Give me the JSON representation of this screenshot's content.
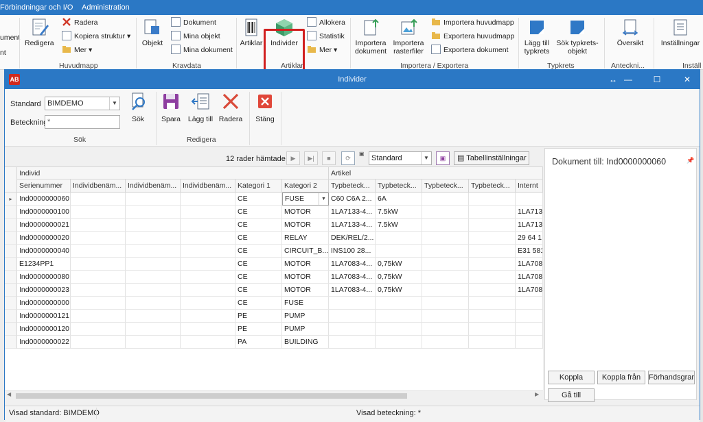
{
  "app": {
    "tabs": [
      "Förbindningar och I/O",
      "Administration"
    ],
    "ribbon": {
      "left_cut": [
        "ument",
        "nt"
      ],
      "huvudmapp": {
        "label": "Huvudmapp",
        "redigera": "Redigera",
        "radera": "Radera",
        "kopiera": "Kopiera struktur",
        "mer": "Mer"
      },
      "kravdata": {
        "label": "Kravdata",
        "objekt": "Objekt",
        "dokument": "Dokument",
        "mina_objekt": "Mina objekt",
        "mina_dokument": "Mina dokument"
      },
      "artiklar": {
        "label": "Artiklar",
        "artiklar": "Artiklar",
        "individer": "Individer",
        "allokera": "Allokera",
        "statistik": "Statistik",
        "mer": "Mer"
      },
      "importera": {
        "label": "Importera / Exportera",
        "imp_dok_1": "Importera",
        "imp_dok_2": "dokument",
        "imp_rast_1": "Importera",
        "imp_rast_2": "rasterfiler",
        "imp_huvud": "Importera huvudmapp",
        "exp_huvud": "Exportera huvudmapp",
        "exp_dok": "Exportera dokument"
      },
      "typkrets": {
        "label": "Typkrets",
        "lagg_1": "Lägg till",
        "lagg_2": "typkrets",
        "sok_1": "Sök typkrets-",
        "sok_2": "objekt"
      },
      "anteckning": {
        "label": "Anteckni...",
        "oversikt": "Översikt"
      },
      "installningar": {
        "label": "Inställ",
        "btn": "Inställningar"
      }
    }
  },
  "dialog": {
    "logo": "AB",
    "title": "Individer",
    "controls": {
      "move": "↔",
      "minimize": "—",
      "maximize": "☐",
      "close": "✕"
    },
    "search": {
      "standard_label": "Standard",
      "standard_value": "BIMDEMO",
      "beteckning_label": "Beteckning",
      "beteckning_value": "*",
      "sok_button": "Sök",
      "group_label": "Sök"
    },
    "edit": {
      "spara": "Spara",
      "lagg_till": "Lägg till",
      "radera": "Radera",
      "group_label": "Redigera"
    },
    "stang": "Stäng",
    "grid_toolbar": {
      "rows_fetched": "12 rader hämtade",
      "view_select": "Standard",
      "table_settings": "Tabellinställningar"
    },
    "grid": {
      "bands": [
        "Individ",
        "Artikel"
      ],
      "columns": [
        "Serienummer",
        "Individbenäm...",
        "Individbenäm...",
        "Individbenäm...",
        "Kategori 1",
        "Kategori 2",
        "Typbeteck...",
        "Typbeteck...",
        "Typbeteck...",
        "Typbeteck...",
        "Internt"
      ],
      "rows": [
        [
          "Ind0000000060",
          "",
          "",
          "",
          "CE",
          "FUSE",
          "C60 C6A 2...",
          "6A",
          "",
          "",
          ""
        ],
        [
          "Ind0000000100",
          "",
          "",
          "",
          "CE",
          "MOTOR",
          "1LA7133-4...",
          "7.5kW",
          "",
          "",
          "1LA713"
        ],
        [
          "Ind0000000021",
          "",
          "",
          "",
          "CE",
          "MOTOR",
          "1LA7133-4...",
          "7.5kW",
          "",
          "",
          "1LA713"
        ],
        [
          "Ind0000000020",
          "",
          "",
          "",
          "CE",
          "RELAY",
          "DEK/REL/2...",
          "",
          "",
          "",
          "29 64 1"
        ],
        [
          "Ind0000000040",
          "",
          "",
          "",
          "CE",
          "CIRCUIT_B...",
          "INS100 28...",
          "",
          "",
          "",
          "E31 581"
        ],
        [
          "E1234PP1",
          "",
          "",
          "",
          "CE",
          "MOTOR",
          "1LA7083-4...",
          "0,75kW",
          "",
          "",
          "1LA708"
        ],
        [
          "Ind0000000080",
          "",
          "",
          "",
          "CE",
          "MOTOR",
          "1LA7083-4...",
          "0,75kW",
          "",
          "",
          "1LA708"
        ],
        [
          "Ind0000000023",
          "",
          "",
          "",
          "CE",
          "MOTOR",
          "1LA7083-4...",
          "0,75kW",
          "",
          "",
          "1LA708"
        ],
        [
          "Ind0000000000",
          "",
          "",
          "",
          "CE",
          "FUSE",
          "",
          "",
          "",
          "",
          ""
        ],
        [
          "Ind0000000121",
          "",
          "",
          "",
          "PE",
          "PUMP",
          "",
          "",
          "",
          "",
          ""
        ],
        [
          "Ind0000000120",
          "",
          "",
          "",
          "PE",
          "PUMP",
          "",
          "",
          "",
          "",
          ""
        ],
        [
          "Ind0000000022",
          "",
          "",
          "",
          "PA",
          "BUILDING",
          "",
          "",
          "",
          "",
          ""
        ]
      ]
    },
    "doc_panel": {
      "title": "Dokument till: Ind0000000060",
      "koppla": "Koppla",
      "koppla_fran": "Koppla från",
      "forhandsgransk": "Förhandsgransk",
      "ga_till": "Gå till"
    },
    "status": {
      "visad_standard": "Visad standard: BIMDEMO",
      "visad_beteckning": "Visad beteckning: *"
    }
  }
}
